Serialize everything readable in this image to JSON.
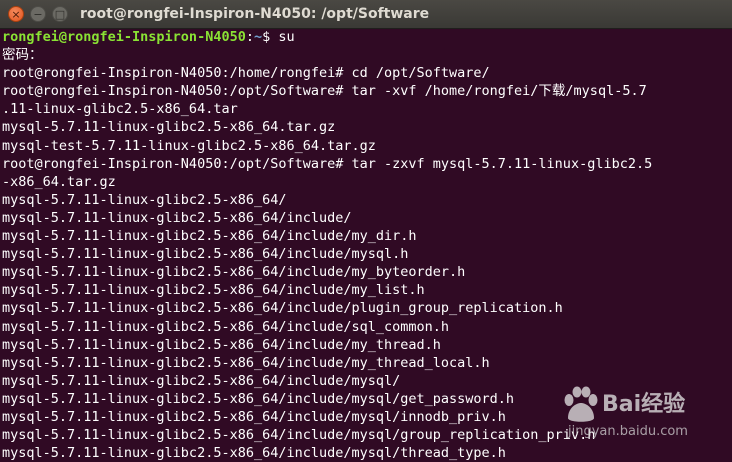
{
  "window": {
    "title": "root@rongfei-Inspiron-N4050: /opt/Software",
    "buttons": {
      "close": "×",
      "minimize": "−",
      "maximize": "□"
    }
  },
  "terminal": {
    "prompt_user": "rongfei@rongfei-Inspiron-N4050",
    "prompt_path": "~",
    "prompt_symbol": "$",
    "first_command": " su",
    "lines": [
      "密码：",
      "root@rongfei-Inspiron-N4050:/home/rongfei# cd /opt/Software/",
      "root@rongfei-Inspiron-N4050:/opt/Software# tar -xvf /home/rongfei/下载/mysql-5.7",
      ".11-linux-glibc2.5-x86_64.tar",
      "mysql-5.7.11-linux-glibc2.5-x86_64.tar.gz",
      "mysql-test-5.7.11-linux-glibc2.5-x86_64.tar.gz",
      "root@rongfei-Inspiron-N4050:/opt/Software# tar -zxvf mysql-5.7.11-linux-glibc2.5",
      "-x86_64.tar.gz",
      "mysql-5.7.11-linux-glibc2.5-x86_64/",
      "mysql-5.7.11-linux-glibc2.5-x86_64/include/",
      "mysql-5.7.11-linux-glibc2.5-x86_64/include/my_dir.h",
      "mysql-5.7.11-linux-glibc2.5-x86_64/include/mysql.h",
      "mysql-5.7.11-linux-glibc2.5-x86_64/include/my_byteorder.h",
      "mysql-5.7.11-linux-glibc2.5-x86_64/include/my_list.h",
      "mysql-5.7.11-linux-glibc2.5-x86_64/include/plugin_group_replication.h",
      "mysql-5.7.11-linux-glibc2.5-x86_64/include/sql_common.h",
      "mysql-5.7.11-linux-glibc2.5-x86_64/include/my_thread.h",
      "mysql-5.7.11-linux-glibc2.5-x86_64/include/my_thread_local.h",
      "mysql-5.7.11-linux-glibc2.5-x86_64/include/mysql/",
      "mysql-5.7.11-linux-glibc2.5-x86_64/include/mysql/get_password.h",
      "mysql-5.7.11-linux-glibc2.5-x86_64/include/mysql/innodb_priv.h",
      "mysql-5.7.11-linux-glibc2.5-x86_64/include/mysql/group_replication_priv.h",
      "mysql-5.7.11-linux-glibc2.5-x86_64/include/mysql/thread_type.h"
    ]
  },
  "watermark": {
    "brand": "Bai",
    "brand_suffix": "经验",
    "sub": "jingyan.baidu.com"
  },
  "colors": {
    "background": "#300a24",
    "prompt_user": "#8ae234",
    "prompt_path": "#729fcf",
    "text": "#ffffff",
    "close_button": "#e0531d"
  }
}
